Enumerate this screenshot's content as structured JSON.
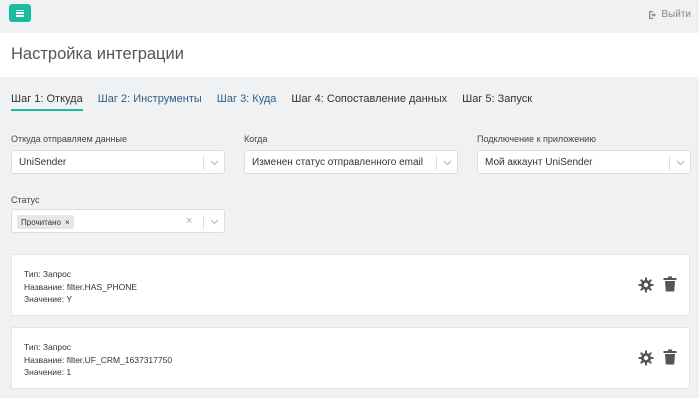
{
  "topbar": {
    "logout_label": "Выйти"
  },
  "header": {
    "title": "Настройка интеграции"
  },
  "tabs": [
    {
      "label": "Шаг 1: Откуда"
    },
    {
      "label": "Шаг 2: Инструменты"
    },
    {
      "label": "Шаг 3: Куда"
    },
    {
      "label": "Шаг 4: Сопоставление данных"
    },
    {
      "label": "Шаг 5: Запуск"
    }
  ],
  "form": {
    "source": {
      "label": "Откуда отправляем данные",
      "value": "UniSender"
    },
    "when": {
      "label": "Когда",
      "value": "Изменен статус отправленного email"
    },
    "connection": {
      "label": "Подключение к приложению",
      "value": "Мой аккаунт UniSender"
    },
    "status": {
      "label": "Статус",
      "tag": "Прочитано",
      "tag_remove": "×",
      "clear": "×"
    }
  },
  "cards": [
    {
      "type": "Тип: Запрос",
      "name": "Название: filter.HAS_PHONE",
      "value": "Значение: Y"
    },
    {
      "type": "Тип: Запрос",
      "name": "Название: filter.UF_CRM_1637317750",
      "value": "Значение: 1"
    }
  ],
  "colors": {
    "accent": "#1abc9c",
    "tab_link": "#2f5f86",
    "icon": "#555555"
  }
}
